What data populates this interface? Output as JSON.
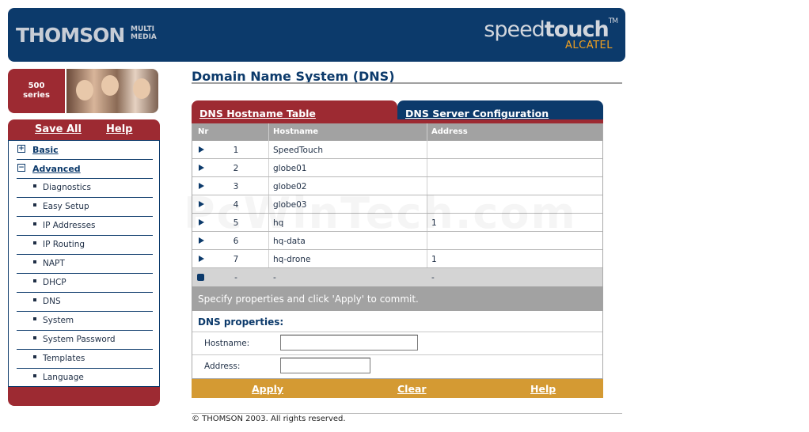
{
  "header": {
    "brand": "THOMSON",
    "brand_sub": "MULTI MEDIA",
    "product_light": "speed",
    "product_bold": "touch",
    "trademark": "TM",
    "maker": "ALCATEL"
  },
  "series_badge": {
    "line1": "500",
    "line2": "series"
  },
  "sidebar": {
    "save_all": "Save All",
    "help": "Help",
    "groups": [
      {
        "icon": "+",
        "label": "Basic"
      },
      {
        "icon": "−",
        "label": "Advanced"
      }
    ],
    "items": [
      "Diagnostics",
      "Easy Setup",
      "IP Addresses",
      "IP Routing",
      "NAPT",
      "DHCP",
      "DNS",
      "System",
      "System Password",
      "Templates",
      "Language"
    ]
  },
  "main": {
    "title": "Domain Name System (DNS)",
    "tabs": [
      {
        "label": "DNS Hostname Table",
        "active": true
      },
      {
        "label": "DNS Server Configuration",
        "active": false
      }
    ],
    "table": {
      "headers": [
        "Nr",
        "Hostname",
        "Address"
      ],
      "rows": [
        {
          "nr": "1",
          "hostname": "SpeedTouch",
          "address": ""
        },
        {
          "nr": "2",
          "hostname": "globe01",
          "address": ""
        },
        {
          "nr": "3",
          "hostname": "globe02",
          "address": ""
        },
        {
          "nr": "4",
          "hostname": "globe03",
          "address": ""
        },
        {
          "nr": "5",
          "hostname": "hq",
          "address": "1"
        },
        {
          "nr": "6",
          "hostname": "hq-data",
          "address": ""
        },
        {
          "nr": "7",
          "hostname": "hq-drone",
          "address": "1"
        }
      ],
      "new_row": {
        "nr": "-",
        "hostname": "-",
        "address": "-"
      }
    },
    "instruction": "Specify properties and click 'Apply' to commit.",
    "properties": {
      "heading": "DNS properties:",
      "hostname_label": "Hostname:",
      "hostname_value": "",
      "address_label": "Address:",
      "address_value": ""
    },
    "actions": {
      "apply": "Apply",
      "clear": "Clear",
      "help": "Help"
    },
    "footer": "© THOMSON 2003. All rights reserved."
  },
  "watermark": "PcWinTech.com",
  "colors": {
    "navy": "#0c3a6b",
    "maroon": "#9d2a32",
    "gold": "#d49a33",
    "gray": "#a2a2a2"
  }
}
